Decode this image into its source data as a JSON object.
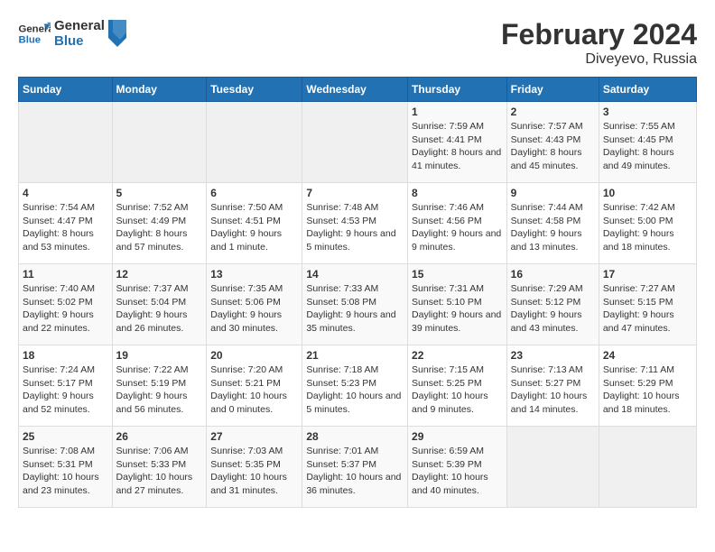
{
  "logo": {
    "general": "General",
    "blue": "Blue"
  },
  "header": {
    "title": "February 2024",
    "subtitle": "Diveyevo, Russia"
  },
  "weekdays": [
    "Sunday",
    "Monday",
    "Tuesday",
    "Wednesday",
    "Thursday",
    "Friday",
    "Saturday"
  ],
  "weeks": [
    [
      {
        "day": "",
        "empty": true
      },
      {
        "day": "",
        "empty": true
      },
      {
        "day": "",
        "empty": true
      },
      {
        "day": "",
        "empty": true
      },
      {
        "day": "1",
        "sunrise": "7:59 AM",
        "sunset": "4:41 PM",
        "daylight": "8 hours and 41 minutes."
      },
      {
        "day": "2",
        "sunrise": "7:57 AM",
        "sunset": "4:43 PM",
        "daylight": "8 hours and 45 minutes."
      },
      {
        "day": "3",
        "sunrise": "7:55 AM",
        "sunset": "4:45 PM",
        "daylight": "8 hours and 49 minutes."
      }
    ],
    [
      {
        "day": "4",
        "sunrise": "7:54 AM",
        "sunset": "4:47 PM",
        "daylight": "8 hours and 53 minutes."
      },
      {
        "day": "5",
        "sunrise": "7:52 AM",
        "sunset": "4:49 PM",
        "daylight": "8 hours and 57 minutes."
      },
      {
        "day": "6",
        "sunrise": "7:50 AM",
        "sunset": "4:51 PM",
        "daylight": "9 hours and 1 minute."
      },
      {
        "day": "7",
        "sunrise": "7:48 AM",
        "sunset": "4:53 PM",
        "daylight": "9 hours and 5 minutes."
      },
      {
        "day": "8",
        "sunrise": "7:46 AM",
        "sunset": "4:56 PM",
        "daylight": "9 hours and 9 minutes."
      },
      {
        "day": "9",
        "sunrise": "7:44 AM",
        "sunset": "4:58 PM",
        "daylight": "9 hours and 13 minutes."
      },
      {
        "day": "10",
        "sunrise": "7:42 AM",
        "sunset": "5:00 PM",
        "daylight": "9 hours and 18 minutes."
      }
    ],
    [
      {
        "day": "11",
        "sunrise": "7:40 AM",
        "sunset": "5:02 PM",
        "daylight": "9 hours and 22 minutes."
      },
      {
        "day": "12",
        "sunrise": "7:37 AM",
        "sunset": "5:04 PM",
        "daylight": "9 hours and 26 minutes."
      },
      {
        "day": "13",
        "sunrise": "7:35 AM",
        "sunset": "5:06 PM",
        "daylight": "9 hours and 30 minutes."
      },
      {
        "day": "14",
        "sunrise": "7:33 AM",
        "sunset": "5:08 PM",
        "daylight": "9 hours and 35 minutes."
      },
      {
        "day": "15",
        "sunrise": "7:31 AM",
        "sunset": "5:10 PM",
        "daylight": "9 hours and 39 minutes."
      },
      {
        "day": "16",
        "sunrise": "7:29 AM",
        "sunset": "5:12 PM",
        "daylight": "9 hours and 43 minutes."
      },
      {
        "day": "17",
        "sunrise": "7:27 AM",
        "sunset": "5:15 PM",
        "daylight": "9 hours and 47 minutes."
      }
    ],
    [
      {
        "day": "18",
        "sunrise": "7:24 AM",
        "sunset": "5:17 PM",
        "daylight": "9 hours and 52 minutes."
      },
      {
        "day": "19",
        "sunrise": "7:22 AM",
        "sunset": "5:19 PM",
        "daylight": "9 hours and 56 minutes."
      },
      {
        "day": "20",
        "sunrise": "7:20 AM",
        "sunset": "5:21 PM",
        "daylight": "10 hours and 0 minutes."
      },
      {
        "day": "21",
        "sunrise": "7:18 AM",
        "sunset": "5:23 PM",
        "daylight": "10 hours and 5 minutes."
      },
      {
        "day": "22",
        "sunrise": "7:15 AM",
        "sunset": "5:25 PM",
        "daylight": "10 hours and 9 minutes."
      },
      {
        "day": "23",
        "sunrise": "7:13 AM",
        "sunset": "5:27 PM",
        "daylight": "10 hours and 14 minutes."
      },
      {
        "day": "24",
        "sunrise": "7:11 AM",
        "sunset": "5:29 PM",
        "daylight": "10 hours and 18 minutes."
      }
    ],
    [
      {
        "day": "25",
        "sunrise": "7:08 AM",
        "sunset": "5:31 PM",
        "daylight": "10 hours and 23 minutes."
      },
      {
        "day": "26",
        "sunrise": "7:06 AM",
        "sunset": "5:33 PM",
        "daylight": "10 hours and 27 minutes."
      },
      {
        "day": "27",
        "sunrise": "7:03 AM",
        "sunset": "5:35 PM",
        "daylight": "10 hours and 31 minutes."
      },
      {
        "day": "28",
        "sunrise": "7:01 AM",
        "sunset": "5:37 PM",
        "daylight": "10 hours and 36 minutes."
      },
      {
        "day": "29",
        "sunrise": "6:59 AM",
        "sunset": "5:39 PM",
        "daylight": "10 hours and 40 minutes."
      },
      {
        "day": "",
        "empty": true
      },
      {
        "day": "",
        "empty": true
      }
    ]
  ]
}
